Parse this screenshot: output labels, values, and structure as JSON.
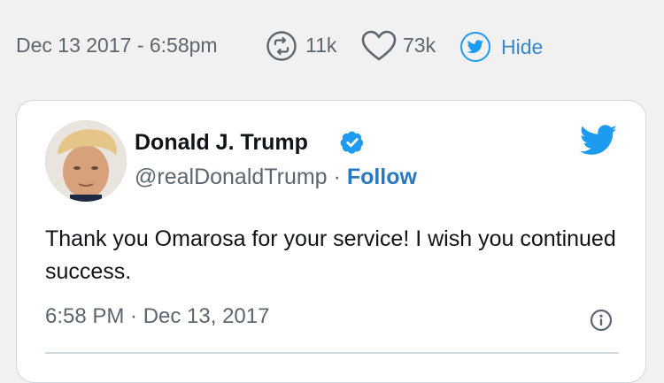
{
  "embed_meta": {
    "date": "Dec 13 2017 - 6:58pm",
    "retweet_count": "11k",
    "like_count": "73k",
    "hide_label": "Hide"
  },
  "tweet": {
    "author_name": "Donald J. Trump",
    "handle": "@realDonaldTrump",
    "separator": " · ",
    "follow_label": "Follow",
    "text": "Thank you Omarosa for your service! I wish you continued success.",
    "timestamp": "6:58 PM · Dec 13, 2017"
  },
  "colors": {
    "link_blue": "#2a78c3",
    "twitter_blue": "#1d9bf0",
    "muted_gray": "#5b6670"
  },
  "icons": {
    "retweet": "retweet-icon",
    "like": "heart-icon",
    "twitter": "twitter-bird-icon",
    "verified": "verified-badge-icon",
    "info": "info-icon"
  }
}
